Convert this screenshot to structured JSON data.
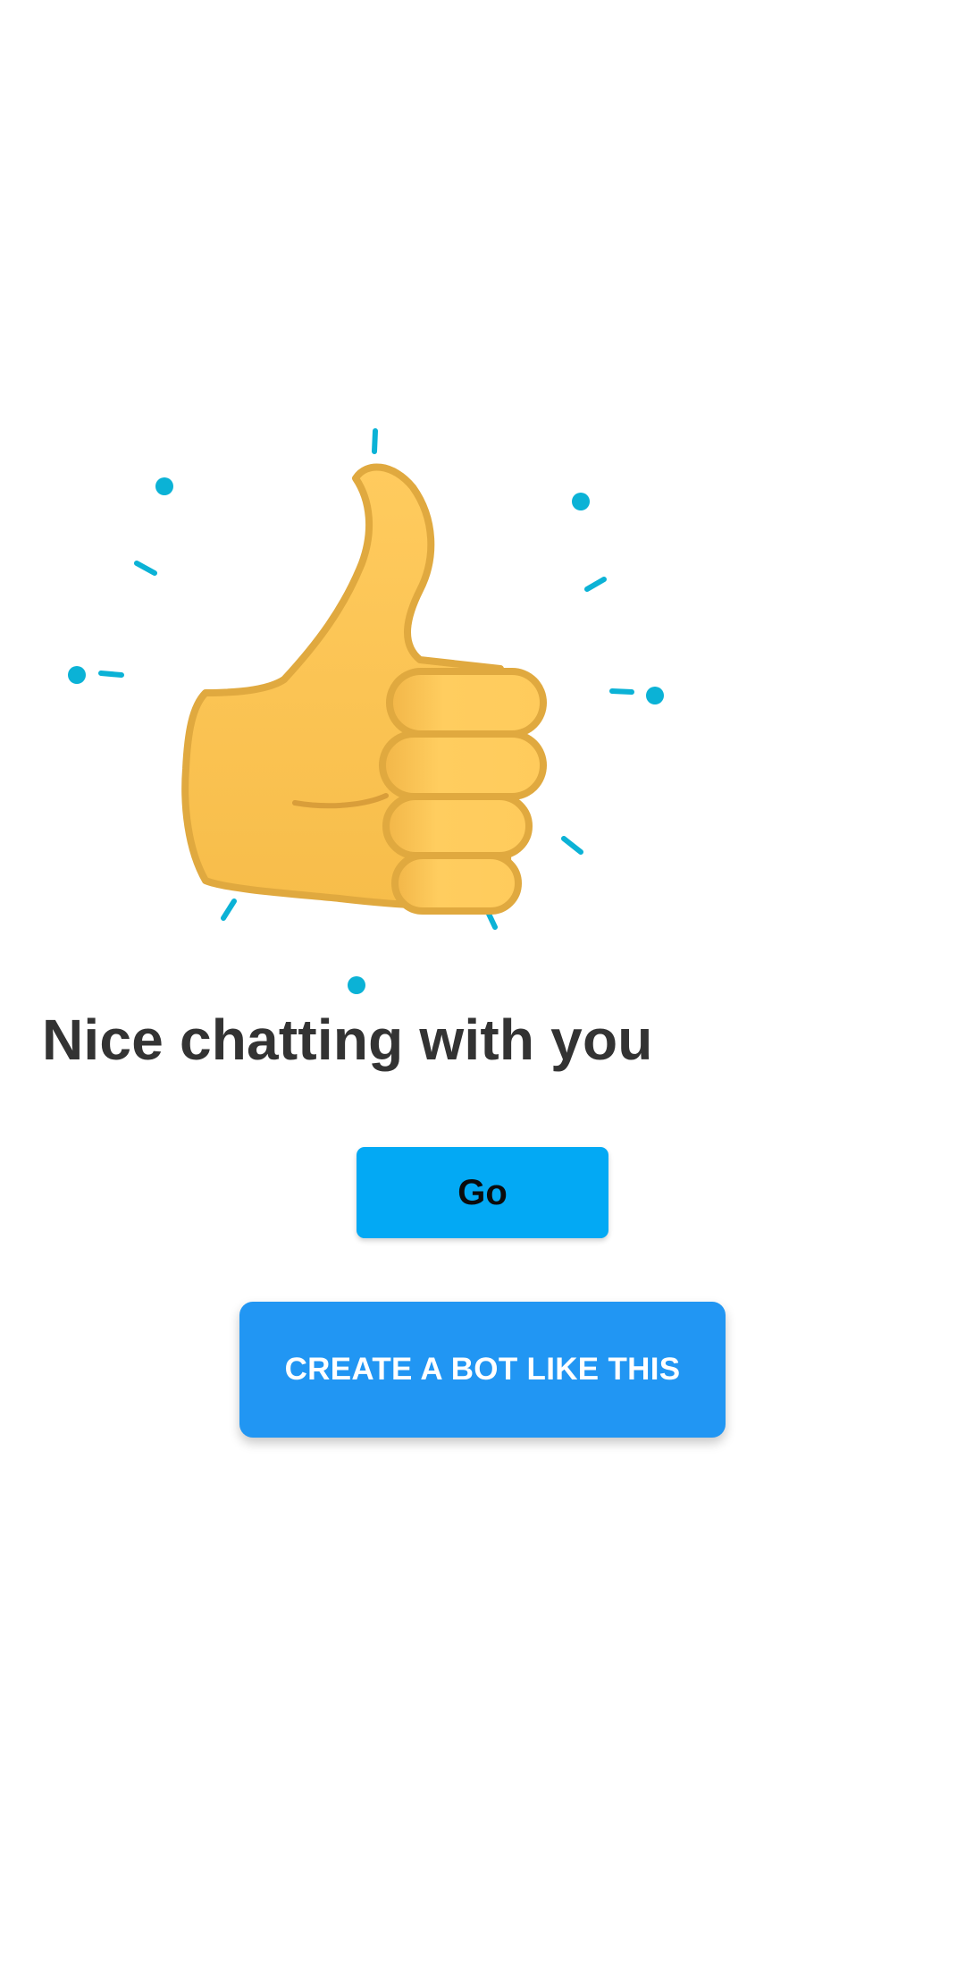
{
  "illustration": {
    "icon": "thumbs-up-icon",
    "accent_color": "#00B4D8",
    "skin_color": "#FFCA5C",
    "outline_color": "#E0A840"
  },
  "message": {
    "title": "Nice chatting with you"
  },
  "actions": {
    "go_label": "Go",
    "go_color": "#03A9F4",
    "create_label": "CREATE A BOT LIKE THIS",
    "create_color": "#2196F3"
  }
}
